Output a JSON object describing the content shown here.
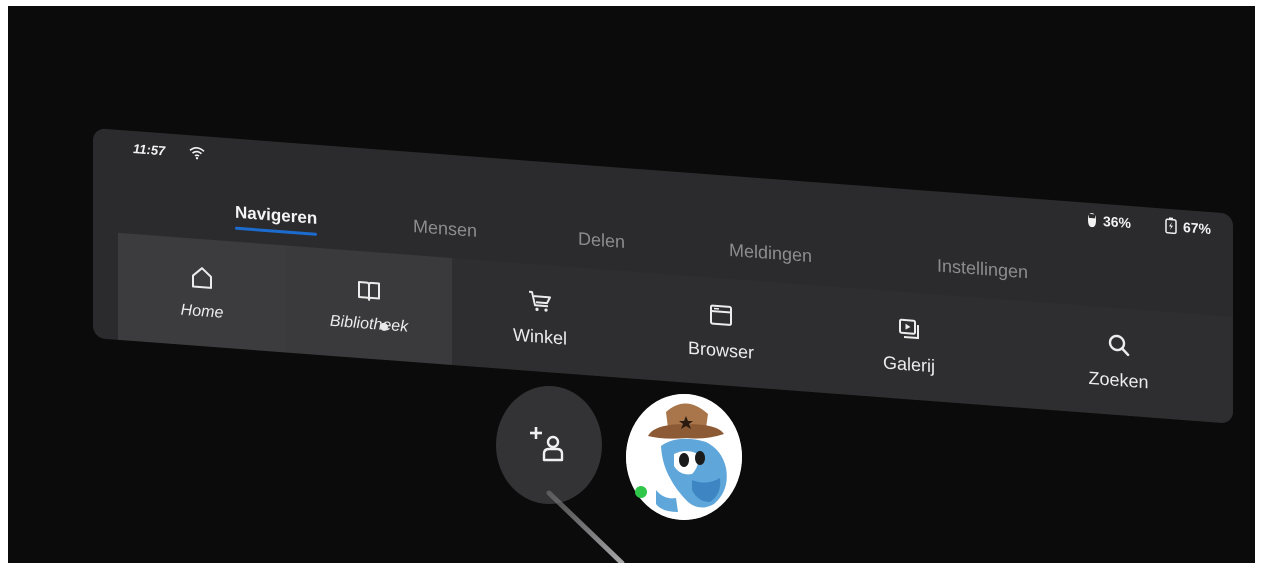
{
  "status_bar": {
    "time": "11:57",
    "controller_battery": "36%",
    "headset_battery": "67%",
    "icons": [
      "wifi-icon",
      "controller-battery-icon",
      "headset-battery-icon"
    ]
  },
  "tabs": [
    {
      "label": "Navigeren",
      "active": true
    },
    {
      "label": "Mensen",
      "active": false
    },
    {
      "label": "Delen",
      "active": false
    },
    {
      "label": "Meldingen",
      "active": false
    },
    {
      "label": "Instellingen",
      "active": false
    }
  ],
  "nav_items": [
    {
      "label": "Home",
      "icon": "home-icon"
    },
    {
      "label": "Bibliotheek",
      "icon": "book-icon"
    },
    {
      "label": "Winkel",
      "icon": "cart-icon"
    },
    {
      "label": "Browser",
      "icon": "browser-window-icon"
    },
    {
      "label": "Galerij",
      "icon": "gallery-icon"
    },
    {
      "label": "Zoeken",
      "icon": "search-icon"
    }
  ],
  "bottom": {
    "add_friend_icon": "add-person-icon",
    "avatar": "user-avatar",
    "status": "online"
  },
  "colors": {
    "background": "#0b0b0b",
    "panel": "#2b2b2d",
    "active_tab_underline": "#1c6cd0",
    "online": "#2fc64a"
  }
}
